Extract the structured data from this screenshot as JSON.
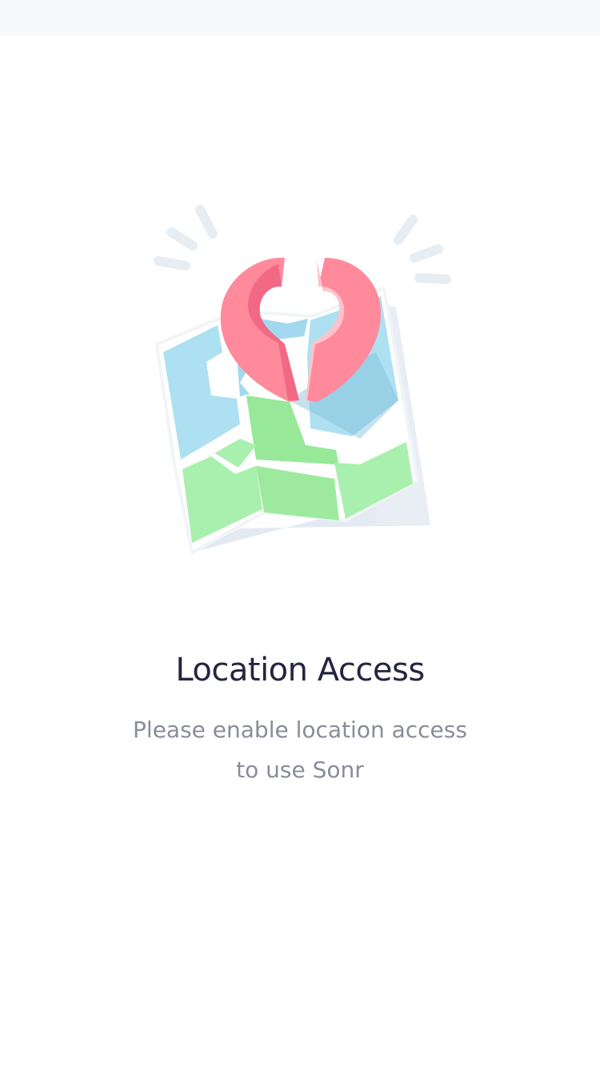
{
  "screen": {
    "title": "Location Access",
    "subtitle_line1": "Please enable location access",
    "subtitle_line2": "to use Sonr"
  },
  "illustration": {
    "icon": "map-with-location-pin-icon",
    "colors": {
      "water": "#ADE0F1",
      "land": "#A9F0AE",
      "land_dark": "#97E898",
      "pin": "#FF8A9B",
      "pin_dark": "#F06381",
      "pin_light": "#FFC2CB",
      "rays": "#E6EDF3",
      "shadow": "#DDE6EE"
    }
  }
}
